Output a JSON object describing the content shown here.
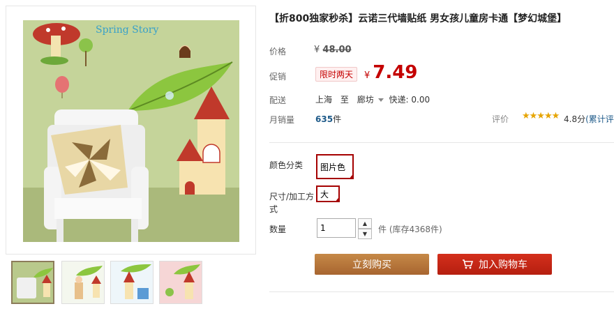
{
  "product": {
    "title": "【折800独家秒杀】云诺三代墙贴纸 男女孩儿童房卡通【梦幻城堡】",
    "image_caption": "Spring Story"
  },
  "price": {
    "label": "价格",
    "currency": "¥",
    "original": "48.00"
  },
  "promo": {
    "label": "促销",
    "tag": "限时两天",
    "currency": "¥",
    "price": "7.49"
  },
  "shipping": {
    "label": "配送",
    "from": "上海",
    "to_word": "至",
    "to": "廊坊",
    "fee": "快递: 0.00"
  },
  "sales": {
    "label": "月销量",
    "count": "635",
    "unit": "件"
  },
  "rating": {
    "label": "评价",
    "stars": "★★★★★",
    "score": "4.8分",
    "more": "(累计评论"
  },
  "options": {
    "color_label": "颜色分类",
    "color_value": "图片色",
    "size_label_line1": "尺寸/加工方",
    "size_label_line2": "式",
    "size_value": "大"
  },
  "quantity": {
    "label": "数量",
    "value": "1",
    "unit_stock": "件 (库存4368件)"
  },
  "buttons": {
    "buy_now": "立刻购买",
    "add_cart": "加入购物车"
  },
  "colors": {
    "promo_red": "#c40000",
    "buy_button": "#b8763a",
    "cart_button": "#c8271a",
    "selected_border": "#a50000"
  }
}
